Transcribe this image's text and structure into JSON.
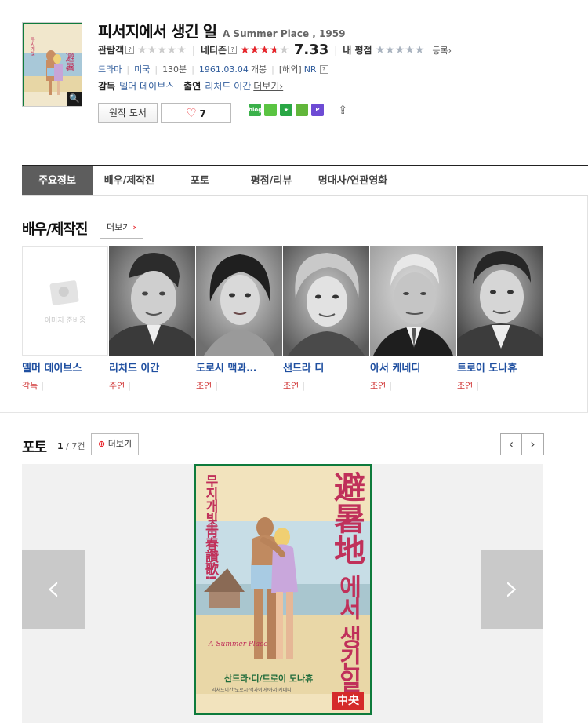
{
  "movie": {
    "title_ko": "피서지에서 생긴 일",
    "title_en": "A Summer Place , 1959",
    "audience_label": "관람객",
    "netizen_label": "네티즌",
    "netizen_score": "7.33",
    "netizen_rating_fraction": 0.733,
    "my_rating_label": "내 평점",
    "register_label": "등록›",
    "help_mark": "?",
    "genre": "드라마",
    "country": "미국",
    "runtime": "130분",
    "release_date": "1961.03.04",
    "release_suffix": "개봉",
    "grade": "[해외]",
    "grade_link": "NR",
    "director_label": "감독",
    "director": "델머 데이브스",
    "cast_label": "출연",
    "cast_line": "리처드 이간",
    "more_label": "더보기›"
  },
  "buttons": {
    "original_book": "원작 도서",
    "like_count": "7"
  },
  "share_icons": [
    {
      "name": "blog-icon",
      "label": "blog",
      "color": "#3bb14a"
    },
    {
      "name": "band-icon",
      "label": "",
      "color": "#5ac442"
    },
    {
      "name": "star-icon",
      "label": "★",
      "color": "#29a745"
    },
    {
      "name": "memo-icon",
      "label": "",
      "color": "#61b63a"
    },
    {
      "name": "plus-icon",
      "label": "P",
      "color": "#6d4bd4"
    }
  ],
  "tabs": [
    {
      "label": "주요정보",
      "active": true
    },
    {
      "label": "배우/제작진",
      "active": false
    },
    {
      "label": "포토",
      "active": false
    },
    {
      "label": "평점/리뷰",
      "active": false
    },
    {
      "label": "명대사/연관영화",
      "active": false
    }
  ],
  "cast_section": {
    "title": "배우/제작진",
    "more": "더보기",
    "people": [
      {
        "name": "델머 데이브스",
        "role": "감독",
        "no_image_text": "이미지 준비중"
      },
      {
        "name": "리처드 이간",
        "role": "주연"
      },
      {
        "name": "도로시 맥과…",
        "role": "조연"
      },
      {
        "name": "샌드라 디",
        "role": "조연"
      },
      {
        "name": "아서 케네디",
        "role": "조연"
      },
      {
        "name": "트로이 도나휴",
        "role": "조연"
      }
    ]
  },
  "photo_section": {
    "title": "포토",
    "current": "1",
    "total": "/ 7건",
    "more": "더보기",
    "poster": {
      "title_hanja": "避暑地",
      "title_hangul_tail": "에서 생긴일",
      "tagline": "무지개빛靑春讚歌!",
      "subtitle_en": "A Summer Place",
      "stars_line": "산드라·디/트로이 도나휴",
      "cast_small": "리처드이간/도로시·맥과이어/아서·케네디",
      "theater": "中央"
    }
  }
}
